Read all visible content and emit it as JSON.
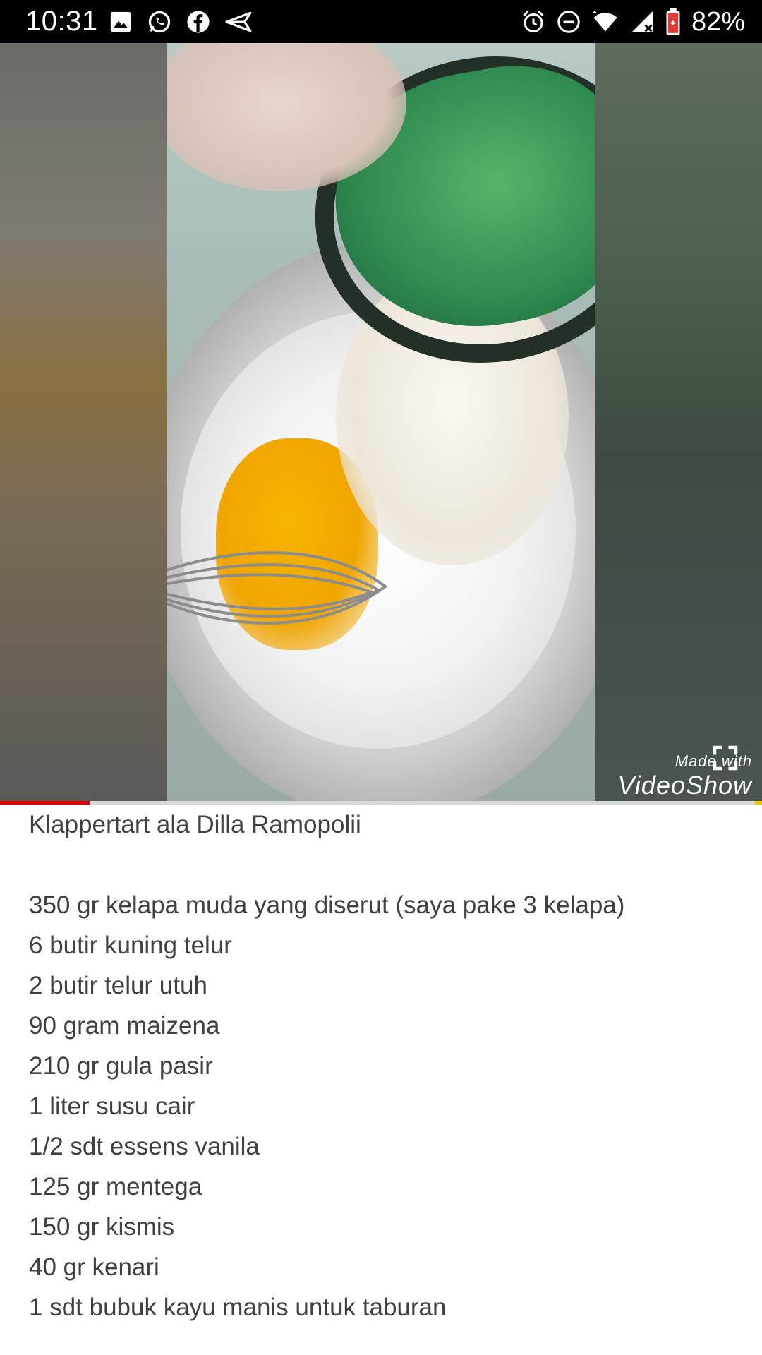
{
  "status_bar": {
    "time": "10:31",
    "notifications": [
      "gallery-icon",
      "whatsapp-icon",
      "facebook-icon",
      "send-icon"
    ],
    "system": [
      "alarm-icon",
      "do-not-disturb-icon",
      "wifi-icon",
      "signal-icon",
      "battery-icon"
    ],
    "battery_percent": "82%"
  },
  "video": {
    "watermark_made": "Made with",
    "watermark_brand": "VideoShow",
    "progress_fraction": 0.118
  },
  "description": {
    "title": "Klappertart ala Dilla Ramopolii",
    "ingredients": [
      "350 gr kelapa muda yang diserut (saya pake 3 kelapa)",
      "6 butir kuning telur",
      "2 butir telur utuh",
      "90 gram maizena",
      "210 gr gula pasir",
      "1 liter susu cair",
      "1/2 sdt essens vanila",
      "125 gr mentega",
      "150 gr kismis",
      "40 gr kenari",
      "1 sdt bubuk kayu manis untuk taburan"
    ]
  },
  "colors": {
    "progress": "#e00000",
    "text": "#404040"
  }
}
